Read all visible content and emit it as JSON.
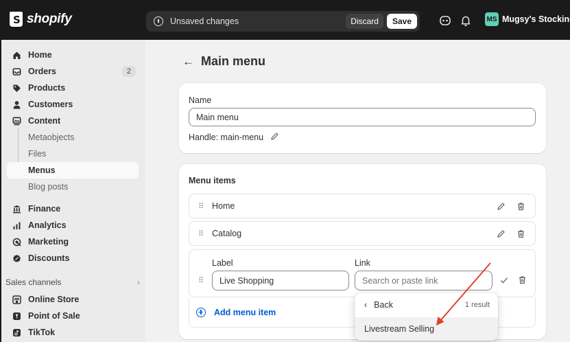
{
  "topbar": {
    "logo_text": "shopify",
    "unsaved_text": "Unsaved changes",
    "discard_label": "Discard",
    "save_label": "Save",
    "store_initials": "MS",
    "store_name": "Mugsy's Stockings",
    "avatar_color": "#5fd0b6"
  },
  "sidebar": {
    "items": [
      {
        "label": "Home",
        "icon": "home-icon"
      },
      {
        "label": "Orders",
        "icon": "orders-icon",
        "badge": "2"
      },
      {
        "label": "Products",
        "icon": "tag-icon"
      },
      {
        "label": "Customers",
        "icon": "person-icon"
      },
      {
        "label": "Content",
        "icon": "content-icon"
      },
      {
        "label": "Metaobjects"
      },
      {
        "label": "Files"
      },
      {
        "label": "Menus"
      },
      {
        "label": "Blog posts"
      },
      {
        "label": "Finance",
        "icon": "bank-icon"
      },
      {
        "label": "Analytics",
        "icon": "bar-chart-icon"
      },
      {
        "label": "Marketing",
        "icon": "target-icon"
      },
      {
        "label": "Discounts",
        "icon": "discount-icon"
      }
    ],
    "sales_channels_label": "Sales channels",
    "channels": [
      {
        "label": "Online Store",
        "icon": "store-icon"
      },
      {
        "label": "Point of Sale",
        "icon": "pos-icon"
      },
      {
        "label": "TikTok",
        "icon": "tiktok-icon"
      }
    ]
  },
  "main": {
    "title": "Main menu",
    "name_label": "Name",
    "name_value": "Main menu",
    "handle_text": "Handle: main-menu",
    "menu_items_title": "Menu items",
    "menu_items": [
      {
        "label": "Home"
      },
      {
        "label": "Catalog"
      }
    ],
    "edit_item": {
      "label_heading": "Label",
      "link_heading": "Link",
      "label_value": "Live Shopping",
      "link_placeholder": "Search or paste link"
    },
    "add_item_label": "Add menu item"
  },
  "dropdown": {
    "back_label": "Back",
    "count_text": "1 result",
    "option": "Livestream Selling"
  },
  "colors": {
    "accent": "#005bd3",
    "annotation_arrow": "#e0412c"
  }
}
